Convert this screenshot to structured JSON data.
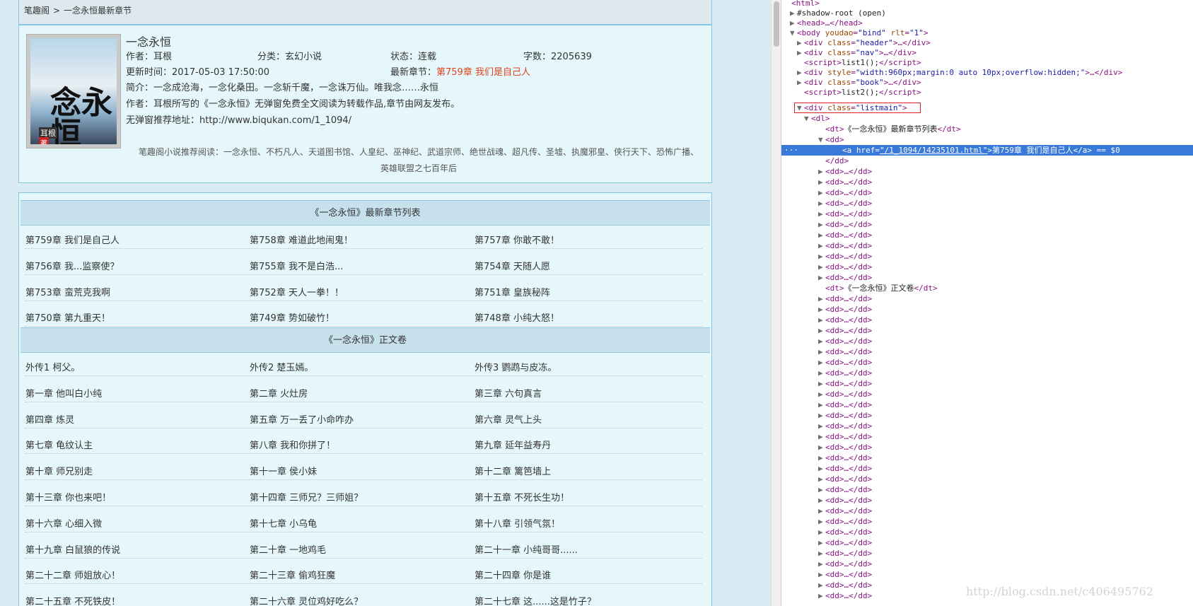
{
  "breadcrumb": {
    "home": "笔趣阁",
    "sep": ">",
    "current": "一念永恒最新章节"
  },
  "book": {
    "cover_text": "念永恒",
    "cover_author": "耳根",
    "cover_badge": "著",
    "title": "一念永恒",
    "author": "作者：耳根",
    "category": "分类：玄幻小说",
    "status": "状态：连载",
    "words": "字数：2205639",
    "updated": "更新时间：2017-05-03 17:50:00",
    "latest_label": "最新章节：",
    "latest_chapter": "第759章 我们是自己人",
    "intro": "简介：一念成沧海，一念化桑田。一念斩千魔，一念诛万仙。唯我念……永恒",
    "note": "作者：耳根所写的《一念永恒》无弹窗免费全文阅读为转载作品,章节由网友发布。",
    "address": "无弹窗推荐地址：http://www.biqukan.com/1_1094/",
    "recommend_line1": "笔趣阁小说推荐阅读：一念永恒、不朽凡人、天道图书馆、人皇纪、巫神纪、武道宗师、绝世战魂、超凡传、圣墟、执魔邪皇、侠行天下、恐怖广播、",
    "recommend_line2": "英雄联盟之七百年后"
  },
  "list": {
    "latest_header": "《一念永恒》最新章节列表",
    "main_header": "《一念永恒》正文卷",
    "latest": [
      "第759章 我们是自己人",
      "第758章 难道此地闹鬼！",
      "第757章 你敢不敢！",
      "第756章 我...监察使？",
      "第755章 我不是白浩...",
      "第754章 天随人愿",
      "第753章 蛮荒克我啊",
      "第752章 天人一拳！！",
      "第751章 皇族秘阵",
      "第750章 第九重天！",
      "第749章 势如破竹！",
      "第748章 小纯大怒！"
    ],
    "main": [
      "外传1 柯父。",
      "外传2 楚玉嫣。",
      "外传3 鹦鹉与皮冻。",
      "第一章 他叫白小纯",
      "第二章 火灶房",
      "第三章 六句真言",
      "第四章 炼灵",
      "第五章 万一丢了小命咋办",
      "第六章 灵气上头",
      "第七章 龟纹认主",
      "第八章 我和你拼了！",
      "第九章 延年益寿丹",
      "第十章 师兄别走",
      "第十一章 侯小妹",
      "第十二章 篱笆墙上",
      "第十三章 你也来吧！",
      "第十四章 三师兄？三师姐？",
      "第十五章 不死长生功！",
      "第十六章 心细入微",
      "第十七章 小乌龟",
      "第十八章 引领气氛！",
      "第十九章 白鼠狼的传说",
      "第二十章 一地鸡毛",
      "第二十一章 小纯哥哥......",
      "第二十二章 师姐放心！",
      "第二十三章 偷鸡狂魔",
      "第二十四章 你是谁",
      "第二十五章 不死铁皮！",
      "第二十六章 灵位鸡好吃么？",
      "第二十七章 这......这是竹子？"
    ]
  },
  "devtools": {
    "html": "<html>",
    "shadow": "#shadow-root (open)",
    "head": "<head>…</head>",
    "body_tag": "<body",
    "body_a1n": "youdao",
    "body_a1v": "\"bind\"",
    "body_a2n": "rlt",
    "body_a2v": "\"1\"",
    "header_n": "class",
    "header_v": "\"header\"",
    "nav_v": "\"nav\"",
    "script1": "list1();",
    "style_n": "style",
    "style_v": "\"width:960px;margin:0 auto 10px;overflow:hidden;\"",
    "book_v": "\"book\"",
    "script2": "list2();",
    "listmain_v": "\"listmain\"",
    "dl": "<dl>",
    "dt1": "《一念永恒》最新章节列表",
    "dd": "<dd>",
    "a_href_n": "href",
    "a_href_v": "\"/1_1094/14235101.html\"",
    "a_text": "第759章 我们是自己人",
    "a_suffix": " == $0",
    "dd_close": "</dd>",
    "dd_collapsed": "<dd>…</dd>",
    "dt2": "《一念永恒》正文卷",
    "dots": "···"
  },
  "watermark": "http://blog.csdn.net/c406495762"
}
